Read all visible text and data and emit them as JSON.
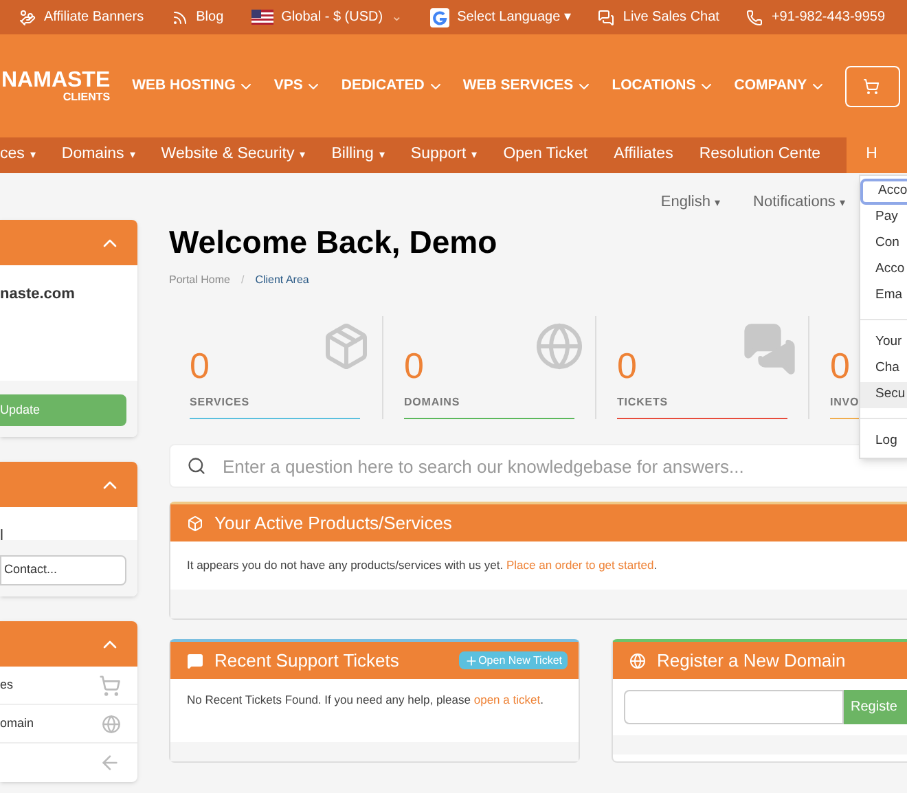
{
  "top_bar": [
    {
      "kind": "hand",
      "label": "Affiliate Banners"
    },
    {
      "kind": "rss",
      "label": "Blog"
    },
    {
      "kind": "flag",
      "label": "Global - $ (USD)",
      "caret": "⌄"
    },
    {
      "kind": "google",
      "label": "Select Language ▾"
    },
    {
      "kind": "chat",
      "label": "Live Sales Chat"
    },
    {
      "kind": "phone",
      "label": "+91-982-443-9959"
    }
  ],
  "logo": {
    "name": "NAMASTE",
    "sub": "CLIENTS"
  },
  "main_menu": [
    "WEB HOSTING",
    "VPS",
    "DEDICATED",
    "WEB SERVICES",
    "LOCATIONS",
    "COMPANY"
  ],
  "client_nav": [
    {
      "label": "ces",
      "caret": "▾"
    },
    {
      "label": "Domains",
      "caret": "▾"
    },
    {
      "label": "Website & Security",
      "caret": "▾"
    },
    {
      "label": "Billing",
      "caret": "▾"
    },
    {
      "label": "Support",
      "caret": "▾"
    },
    {
      "label": "Open Ticket"
    },
    {
      "label": "Affiliates"
    },
    {
      "label": "Resolution Cente"
    },
    {
      "label": "H",
      "selected": true
    }
  ],
  "sidebar": [
    {
      "text": "naste.com",
      "button": "Update"
    },
    {
      "text": "l",
      "select": "Contact..."
    },
    {
      "links": [
        {
          "label": "es"
        },
        {
          "label": "omain"
        }
      ],
      "back_link": true
    }
  ],
  "lang_bar": [
    {
      "label": "English",
      "caret": "▾"
    },
    {
      "label": "Notifications",
      "caret": "▾"
    }
  ],
  "title": "Welcome Back, Demo",
  "breadcrumb": {
    "separator": "/",
    "items": [
      {
        "label": "Portal Home",
        "selected": false
      },
      {
        "label": "Client Area",
        "selected": true
      }
    ]
  },
  "stats": [
    {
      "value": "0",
      "label": "SERVICES",
      "color": "#5bc0de"
    },
    {
      "value": "0",
      "label": "DOMAINS",
      "color": "#5cb85c"
    },
    {
      "value": "0",
      "label": "TICKETS",
      "color": "#e74c3c"
    },
    {
      "value": "0",
      "label": "INVO",
      "color": "#f0ad4e"
    }
  ],
  "search": {
    "placeholder": "Enter a question here to search our knowledgebase for answers..."
  },
  "products_panel": {
    "title": "Your Active Products/Services",
    "text": "It appears you do not have any products/services with us yet.",
    "link": "Place an order to get started",
    "end": "."
  },
  "tickets_panel": {
    "title": "Recent Support Tickets",
    "button": "Open New Ticket",
    "text": "No Recent Tickets Found. If you need any help, please",
    "link": "open a ticket",
    "end": "."
  },
  "domain_panel": {
    "title": "Register a New Domain",
    "button": "Registe"
  },
  "account_menu": [
    {
      "items": [
        {
          "label": "Acco",
          "selected": true,
          "hover": false
        },
        {
          "label": "Pay",
          "selected": false,
          "hover": false
        },
        {
          "label": "Con",
          "selected": false,
          "hover": false
        },
        {
          "label": "Acco",
          "selected": false,
          "hover": false
        },
        {
          "label": "Ema",
          "selected": false,
          "hover": false
        }
      ]
    },
    {
      "items": [
        {
          "label": "Your",
          "selected": false,
          "hover": false
        },
        {
          "label": "Cha",
          "selected": false,
          "hover": false
        },
        {
          "label": "Secu",
          "selected": false,
          "hover": true
        }
      ]
    },
    {
      "items": [
        {
          "label": "Log",
          "selected": false,
          "hover": false
        }
      ]
    }
  ]
}
